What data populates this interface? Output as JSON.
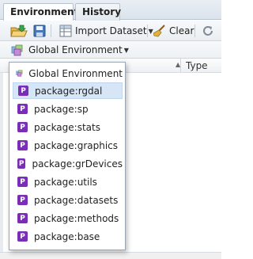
{
  "tabs": [
    {
      "label": "Environment",
      "active": true
    },
    {
      "label": "History",
      "active": false
    }
  ],
  "toolbar": {
    "open_icon": "folder-open-icon",
    "save_icon": "save-icon",
    "import_label": "Import Dataset",
    "clear_label": "Clear",
    "refresh_icon": "refresh-icon"
  },
  "env_selector": {
    "label": "Global Environment",
    "icon": "environment-cube-icon"
  },
  "grid": {
    "type_header": "Type"
  },
  "dropdown": {
    "items": [
      {
        "label": "Global Environment",
        "icon": "environment-cube-icon"
      },
      {
        "label": "package:rgdal",
        "icon": "package-icon",
        "selected": true
      },
      {
        "label": "package:sp",
        "icon": "package-icon"
      },
      {
        "label": "package:stats",
        "icon": "package-icon"
      },
      {
        "label": "package:graphics",
        "icon": "package-icon"
      },
      {
        "label": "package:grDevices",
        "icon": "package-icon"
      },
      {
        "label": "package:utils",
        "icon": "package-icon"
      },
      {
        "label": "package:datasets",
        "icon": "package-icon"
      },
      {
        "label": "package:methods",
        "icon": "package-icon"
      },
      {
        "label": "package:base",
        "icon": "package-icon"
      }
    ]
  },
  "colors": {
    "package_icon": "#7a2db6",
    "selection": "#d6e6f7"
  }
}
